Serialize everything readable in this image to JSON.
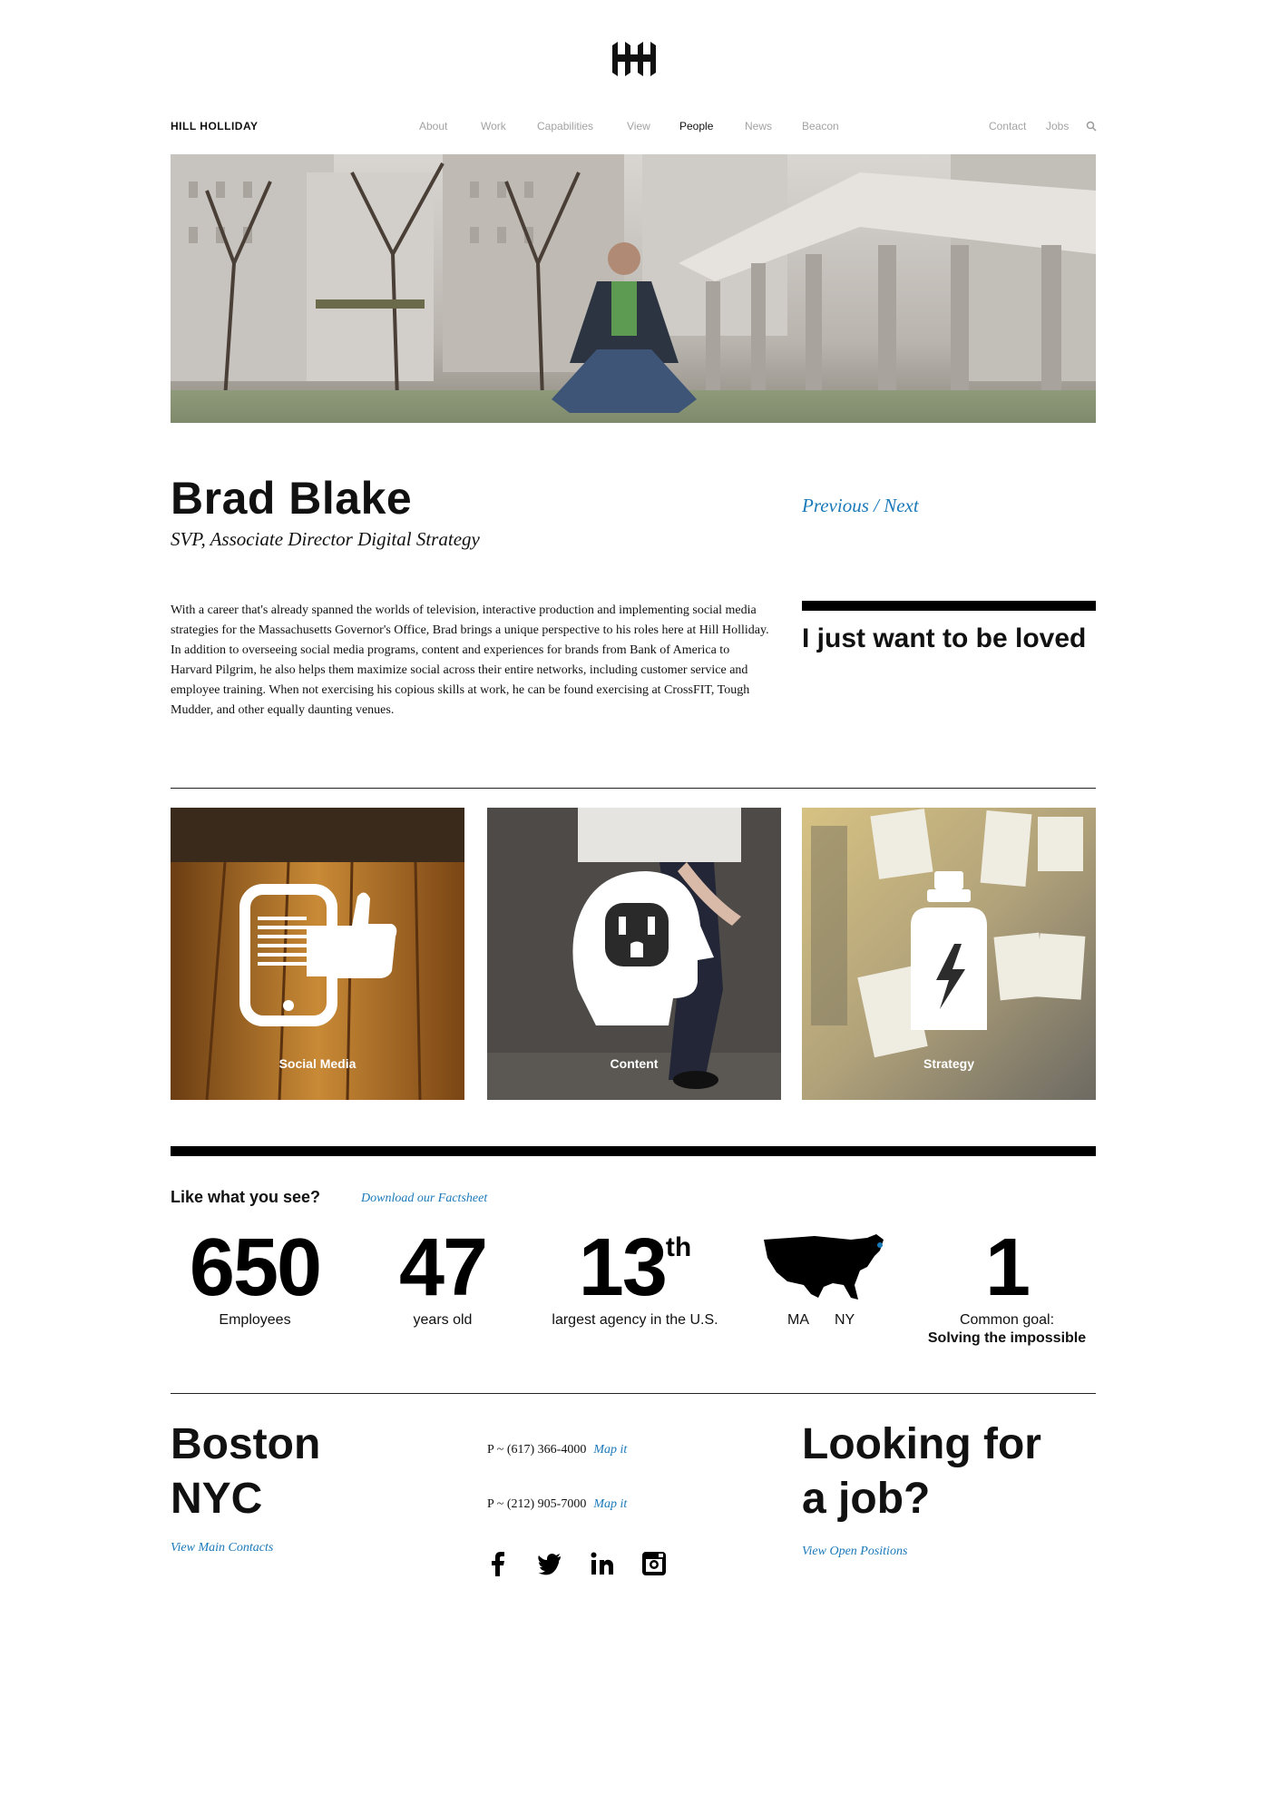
{
  "brand": "HILL HOLLIDAY",
  "nav": {
    "main": [
      "About",
      "Work",
      "Capabilities",
      "View",
      "People",
      "News",
      "Beacon"
    ],
    "active": "People",
    "right": [
      "Contact",
      "Jobs"
    ]
  },
  "person": {
    "name": "Brad Blake",
    "title": "SVP, Associate Director Digital Strategy",
    "previous": "Previous",
    "separator": "/",
    "next": "Next",
    "bio": "With a career that's already spanned the worlds of television, interactive production and implementing social media strategies for the Massachusetts Governor's Office, Brad brings a unique perspective to his roles here at Hill Holliday. In addition to overseeing social media programs, content and experiences for brands from Bank of America to Harvard Pilgrim, he also helps them maximize social across their entire networks, including customer service and employee training. When not exercising his copious skills at work, he can be found exercising at CrossFIT, Tough Mudder, and other equally daunting venues.",
    "quote": "I just want to be loved"
  },
  "tiles": [
    {
      "label": "Social Media",
      "icon": "phone-thumbs-up-icon"
    },
    {
      "label": "Content",
      "icon": "head-outlet-icon"
    },
    {
      "label": "Strategy",
      "icon": "battery-bottle-icon"
    }
  ],
  "stats": {
    "heading": "Like what you see?",
    "factsheet": "Download our Factsheet",
    "employees": {
      "value": "650",
      "label": "Employees"
    },
    "years": {
      "value": "47",
      "label": "years old"
    },
    "rank": {
      "value": "13",
      "suffix": "th",
      "label": "largest agency in the U.S."
    },
    "locations": {
      "a": "MA",
      "b": "NY"
    },
    "goal": {
      "value": "1",
      "label": "Common goal:",
      "bold": "Solving the impossible"
    }
  },
  "footer": {
    "city1": "Boston",
    "city2": "NYC",
    "contacts": "View Main Contacts",
    "phone1": "P ~ (617) 366-4000",
    "phone2": "P ~ (212) 905-7000",
    "mapit": "Map it",
    "job_line1": "Looking for",
    "job_line2": "a job?",
    "positions": "View Open Positions"
  },
  "colors": {
    "link": "#1a79b9",
    "text": "#111111",
    "muted": "#a3a3a3"
  }
}
